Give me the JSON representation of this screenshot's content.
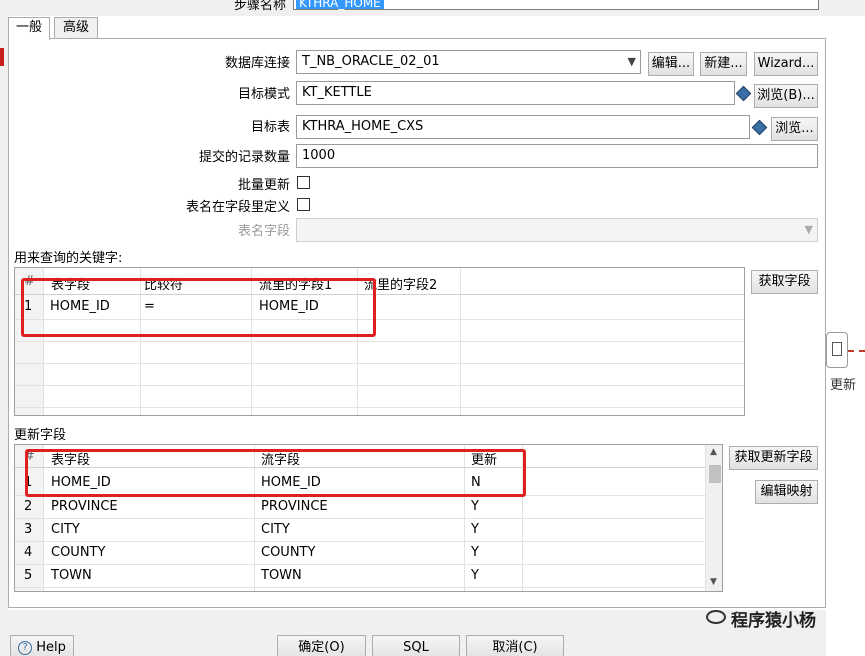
{
  "window": {
    "step_name_label": "步骤名称",
    "step_name_value": "KTHRA_HOME"
  },
  "tabs": [
    {
      "label": "一般",
      "active": true
    },
    {
      "label": "高级",
      "active": false
    }
  ],
  "form": {
    "db_connection_label": "数据库连接",
    "db_connection_value": "T_NB_ORACLE_02_01",
    "edit_button": "编辑...",
    "new_button": "新建...",
    "wizard_button": "Wizard...",
    "target_schema_label": "目标模式",
    "target_schema_value": "KT_KETTLE",
    "browse_b_button": "浏览(B)...",
    "target_table_label": "目标表",
    "target_table_value": "KTHRA_HOME_CXS",
    "browse_button": "浏览...",
    "commit_size_label": "提交的记录数量",
    "commit_size_value": "1000",
    "batch_update_label": "批量更新",
    "table_name_in_field_label": "表名在字段里定义",
    "table_name_field_label": "表名字段"
  },
  "keys_section": {
    "title": "用来查询的关键字:",
    "get_fields_button": "获取字段",
    "columns": [
      "#",
      "表字段",
      "比较符",
      "流里的字段1",
      "流里的字段2"
    ],
    "rows": [
      [
        "1",
        "HOME_ID",
        "=",
        "HOME_ID",
        ""
      ]
    ]
  },
  "update_section": {
    "title": "更新字段",
    "get_update_fields_button": "获取更新字段",
    "edit_mapping_button": "编辑映射",
    "columns": [
      "#",
      "表字段",
      "流字段",
      "更新"
    ],
    "rows": [
      [
        "1",
        "HOME_ID",
        "HOME_ID",
        "N"
      ],
      [
        "2",
        "PROVINCE",
        "PROVINCE",
        "Y"
      ],
      [
        "3",
        "CITY",
        "CITY",
        "Y"
      ],
      [
        "4",
        "COUNTY",
        "COUNTY",
        "Y"
      ],
      [
        "5",
        "TOWN",
        "TOWN",
        "Y"
      ]
    ]
  },
  "footer": {
    "help_button": "Help",
    "ok_button": "确定(O)",
    "sql_button": "SQL",
    "cancel_button": "取消(C)"
  },
  "side": {
    "update_label": "更新",
    "watermark": "程序猿小杨"
  },
  "colors": {
    "highlight_box": "#e02020",
    "selection": "#3399ff"
  }
}
